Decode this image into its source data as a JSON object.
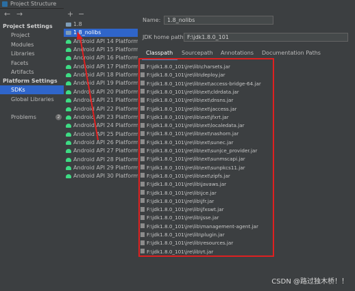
{
  "window": {
    "title": "Project Structure"
  },
  "nav": {
    "back": "←",
    "forward": "→"
  },
  "sidebar": {
    "project_settings_title": "Project Settings",
    "project_items": [
      "Project",
      "Modules",
      "Libraries",
      "Facets",
      "Artifacts"
    ],
    "platform_settings_title": "Platform Settings",
    "platform_items": [
      "SDKs",
      "Global Libraries"
    ],
    "problems_label": "Problems",
    "problems_count": "2"
  },
  "sdk_toolbar": {
    "add": "+",
    "remove": "−"
  },
  "sdks": [
    "1.8",
    "1.8_nolibs",
    "Android API 14 Platform",
    "Android API 15 Platform",
    "Android API 16 Platform",
    "Android API 17 Platform",
    "Android API 18 Platform",
    "Android API 19 Platform",
    "Android API 20 Platform",
    "Android API 21 Platform",
    "Android API 22 Platform",
    "Android API 23 Platform",
    "Android API 24 Platform",
    "Android API 25 Platform",
    "Android API 26 Platform",
    "Android API 27 Platform",
    "Android API 28 Platform",
    "Android API 29 Platform",
    "Android API 30 Platform"
  ],
  "detail": {
    "name_label": "Name:",
    "name_value": "1.8_nolibs",
    "home_label": "JDK home path:",
    "home_value": "F:\\jdk1.8.0_101",
    "tabs": [
      "Classpath",
      "Sourcepath",
      "Annotations",
      "Documentation Paths"
    ],
    "classpath": [
      "F:\\jdk1.8.0_101\\jre\\lib\\charsets.jar",
      "F:\\jdk1.8.0_101\\jre\\lib\\deploy.jar",
      "F:\\jdk1.8.0_101\\jre\\lib\\ext\\access-bridge-64.jar",
      "F:\\jdk1.8.0_101\\jre\\lib\\ext\\cldrdata.jar",
      "F:\\jdk1.8.0_101\\jre\\lib\\ext\\dnsns.jar",
      "F:\\jdk1.8.0_101\\jre\\lib\\ext\\jaccess.jar",
      "F:\\jdk1.8.0_101\\jre\\lib\\ext\\jfxrt.jar",
      "F:\\jdk1.8.0_101\\jre\\lib\\ext\\localedata.jar",
      "F:\\jdk1.8.0_101\\jre\\lib\\ext\\nashorn.jar",
      "F:\\jdk1.8.0_101\\jre\\lib\\ext\\sunec.jar",
      "F:\\jdk1.8.0_101\\jre\\lib\\ext\\sunjce_provider.jar",
      "F:\\jdk1.8.0_101\\jre\\lib\\ext\\sunmscapi.jar",
      "F:\\jdk1.8.0_101\\jre\\lib\\ext\\sunpkcs11.jar",
      "F:\\jdk1.8.0_101\\jre\\lib\\ext\\zipfs.jar",
      "F:\\jdk1.8.0_101\\jre\\lib\\javaws.jar",
      "F:\\jdk1.8.0_101\\jre\\lib\\jce.jar",
      "F:\\jdk1.8.0_101\\jre\\lib\\jfr.jar",
      "F:\\jdk1.8.0_101\\jre\\lib\\jfxswt.jar",
      "F:\\jdk1.8.0_101\\jre\\lib\\jsse.jar",
      "F:\\jdk1.8.0_101\\jre\\lib\\management-agent.jar",
      "F:\\jdk1.8.0_101\\jre\\lib\\plugin.jar",
      "F:\\jdk1.8.0_101\\jre\\lib\\resources.jar",
      "F:\\jdk1.8.0_101\\jre\\lib\\rt.jar"
    ]
  },
  "watermark": "CSDN @路过独木桥！！",
  "colors": {
    "background": "#3c3f41",
    "selection": "#2f65ca",
    "highlight_box": "#e02020",
    "android_icon": "#3ddc84",
    "tab_underline": "#4a88c7"
  }
}
